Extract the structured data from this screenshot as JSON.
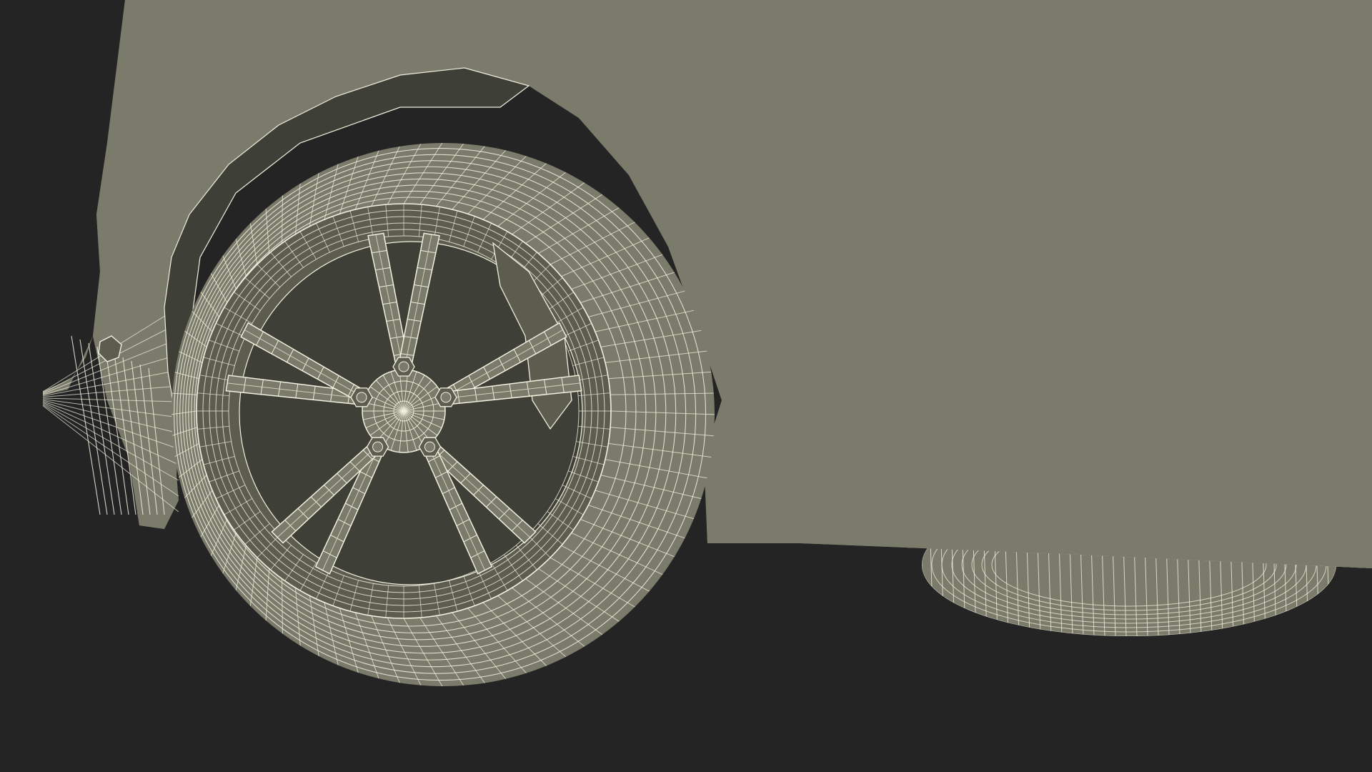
{
  "scene": {
    "subject": "car-front-wheel-wireframe",
    "render_style": "wireframe-on-clay",
    "colors": {
      "background": "#242424",
      "clay": "#7a7b6a",
      "clay_dark": "#5c5d4f",
      "clay_shadow": "#3e3f36",
      "wire": "#f2f0df",
      "wire_soft": "#d9d7c4"
    },
    "wheel": {
      "spoke_count": 10,
      "lug_nut_count": 5
    }
  }
}
